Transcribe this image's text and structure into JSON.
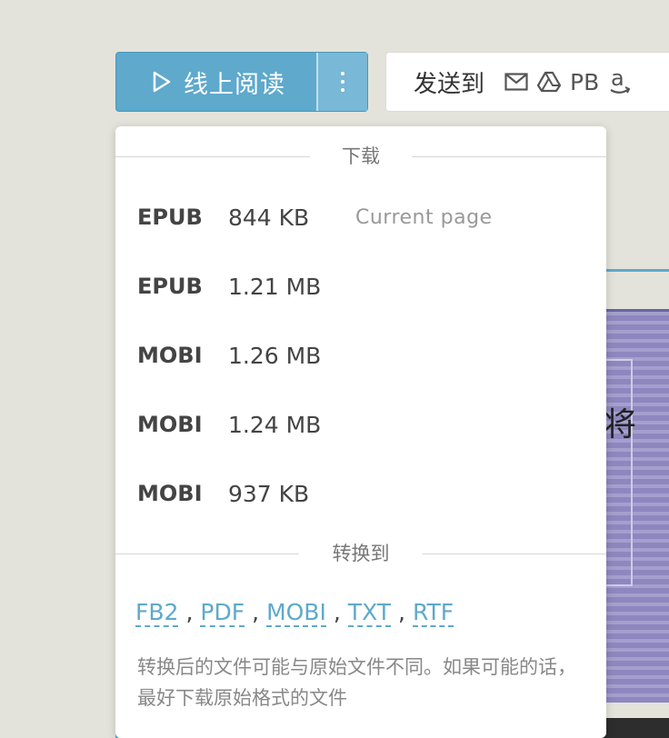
{
  "read_button": {
    "label": "线上阅读",
    "more_icon": "more-vertical-icon"
  },
  "send_button": {
    "label": "发送到",
    "pb": "PB",
    "icons": [
      "mail-icon",
      "google-drive-icon",
      "pocketbook-icon",
      "amazon-icon"
    ]
  },
  "background": {
    "char": "将"
  },
  "dropdown": {
    "download_header": "下载",
    "items": [
      {
        "format": "EPUB",
        "size": "844 KB",
        "note": "Current page"
      },
      {
        "format": "EPUB",
        "size": "1.21 MB",
        "note": ""
      },
      {
        "format": "MOBI",
        "size": "1.26 MB",
        "note": ""
      },
      {
        "format": "MOBI",
        "size": "1.24 MB",
        "note": ""
      },
      {
        "format": "MOBI",
        "size": "937 KB",
        "note": ""
      }
    ],
    "convert_header": "转换到",
    "convert_formats": [
      "FB2",
      "PDF",
      "MOBI",
      "TXT",
      "RTF"
    ],
    "convert_separator": ",",
    "note": "转换后的文件可能与原始文件不同。如果可能的话，最好下载原始格式的文件"
  },
  "colors": {
    "accent": "#5ea9cc",
    "background": "#e3e3db"
  }
}
